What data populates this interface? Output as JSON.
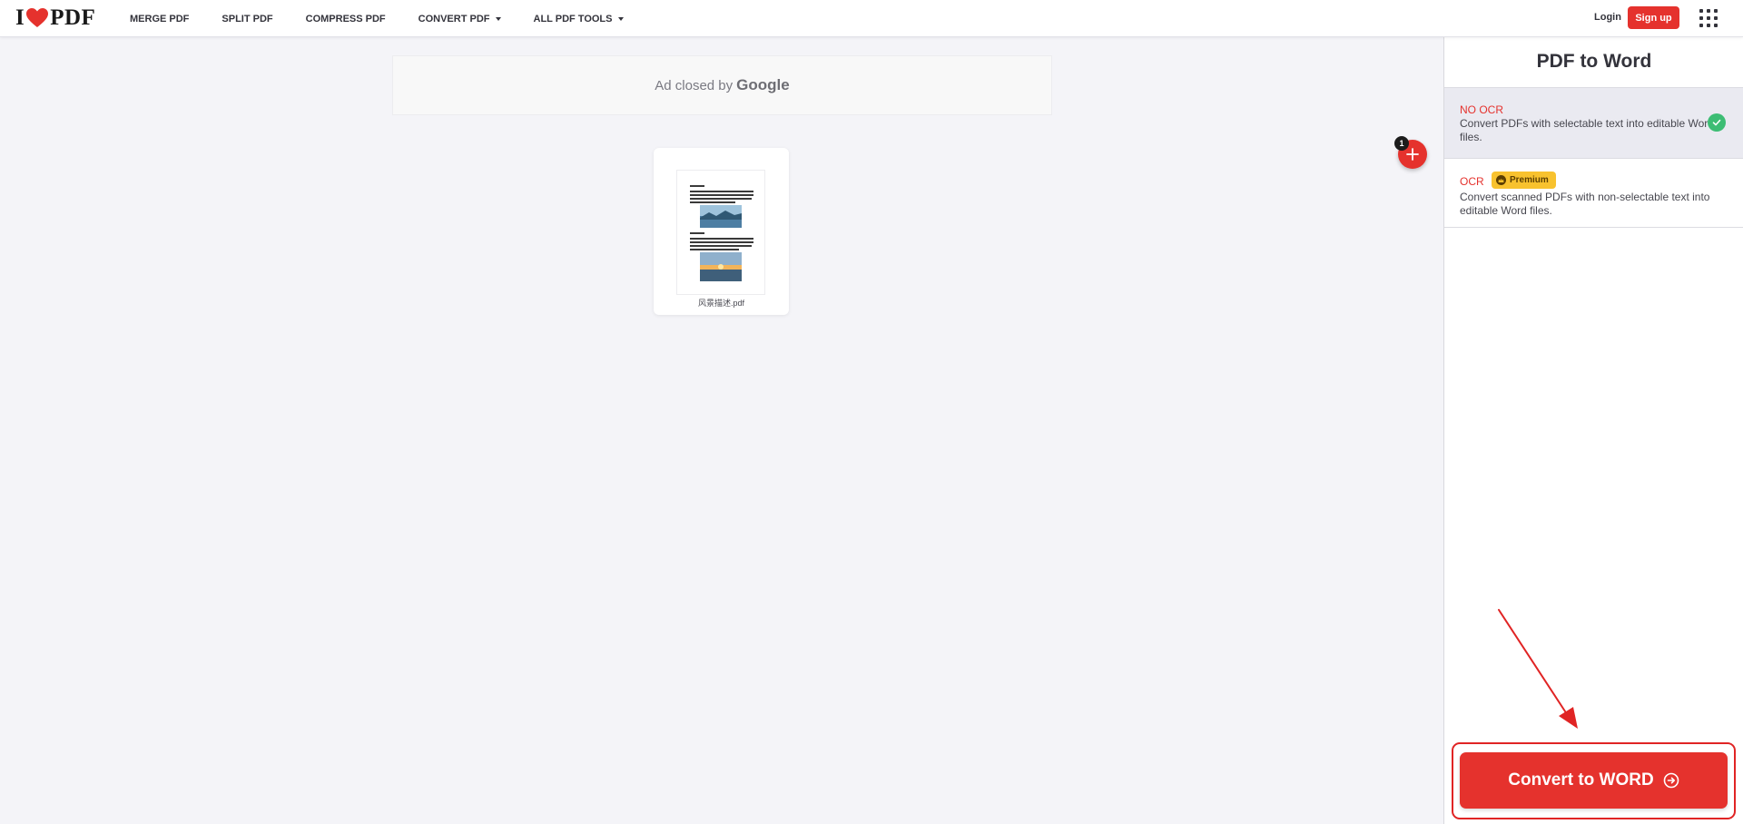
{
  "brand": {
    "logo_left": "I",
    "logo_right": "PDF",
    "accent_color": "#e5322d"
  },
  "nav": {
    "items": [
      {
        "label": "MERGE PDF",
        "dropdown": false
      },
      {
        "label": "SPLIT PDF",
        "dropdown": false
      },
      {
        "label": "COMPRESS PDF",
        "dropdown": false
      },
      {
        "label": "CONVERT PDF",
        "dropdown": true
      },
      {
        "label": "ALL PDF TOOLS",
        "dropdown": true
      }
    ],
    "login_label": "Login",
    "signup_label": "Sign up",
    "apps_icon": "grid-icon"
  },
  "ad": {
    "text": "Ad closed by",
    "brand": "Google"
  },
  "file": {
    "name": "风景描述.pdf",
    "count": "1"
  },
  "sidebar": {
    "title": "PDF to Word",
    "options": [
      {
        "label": "NO OCR",
        "description": "Convert PDFs with selectable text into editable Word files.",
        "selected": true
      },
      {
        "label": "OCR",
        "badge": "Premium",
        "description": "Convert scanned PDFs with non-selectable text into editable Word files.",
        "selected": false
      }
    ],
    "convert_label": "Convert to WORD"
  },
  "colors": {
    "success": "#3dbd74",
    "premium": "#f8c22e",
    "annotation": "#e02424"
  }
}
